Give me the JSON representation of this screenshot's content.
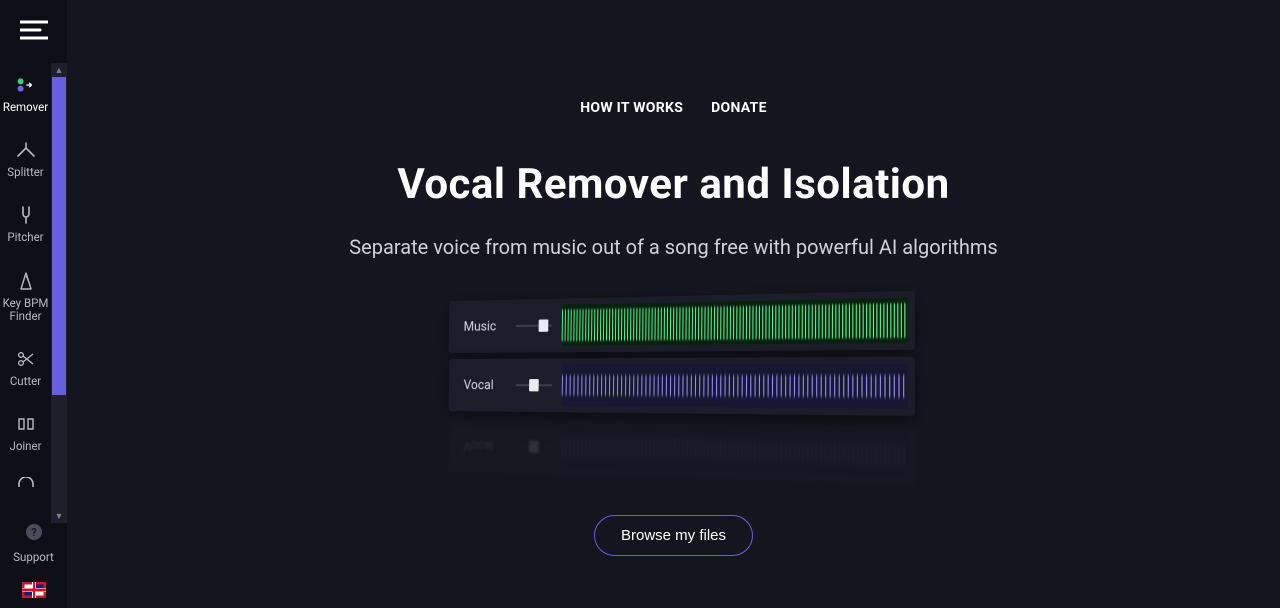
{
  "sidebar": {
    "items": [
      {
        "label": "Remover"
      },
      {
        "label": "Splitter"
      },
      {
        "label": "Pitcher"
      },
      {
        "label": "Key BPM Finder"
      },
      {
        "label": "Cutter"
      },
      {
        "label": "Joiner"
      }
    ],
    "support_label": "Support"
  },
  "topnav": {
    "how_it_works": "HOW IT WORKS",
    "donate": "DONATE"
  },
  "hero": {
    "title": "Vocal Remover and Isolation",
    "subtitle": "Separate voice from music out of a song free with powerful AI algorithms"
  },
  "player": {
    "music_label": "Music",
    "vocal_label": "Vocal"
  },
  "cta": {
    "browse_label": "Browse my files"
  },
  "colors": {
    "accent": "#665fe0",
    "music_wave": "#21d36a",
    "vocal_wave": "#8e89f0"
  }
}
